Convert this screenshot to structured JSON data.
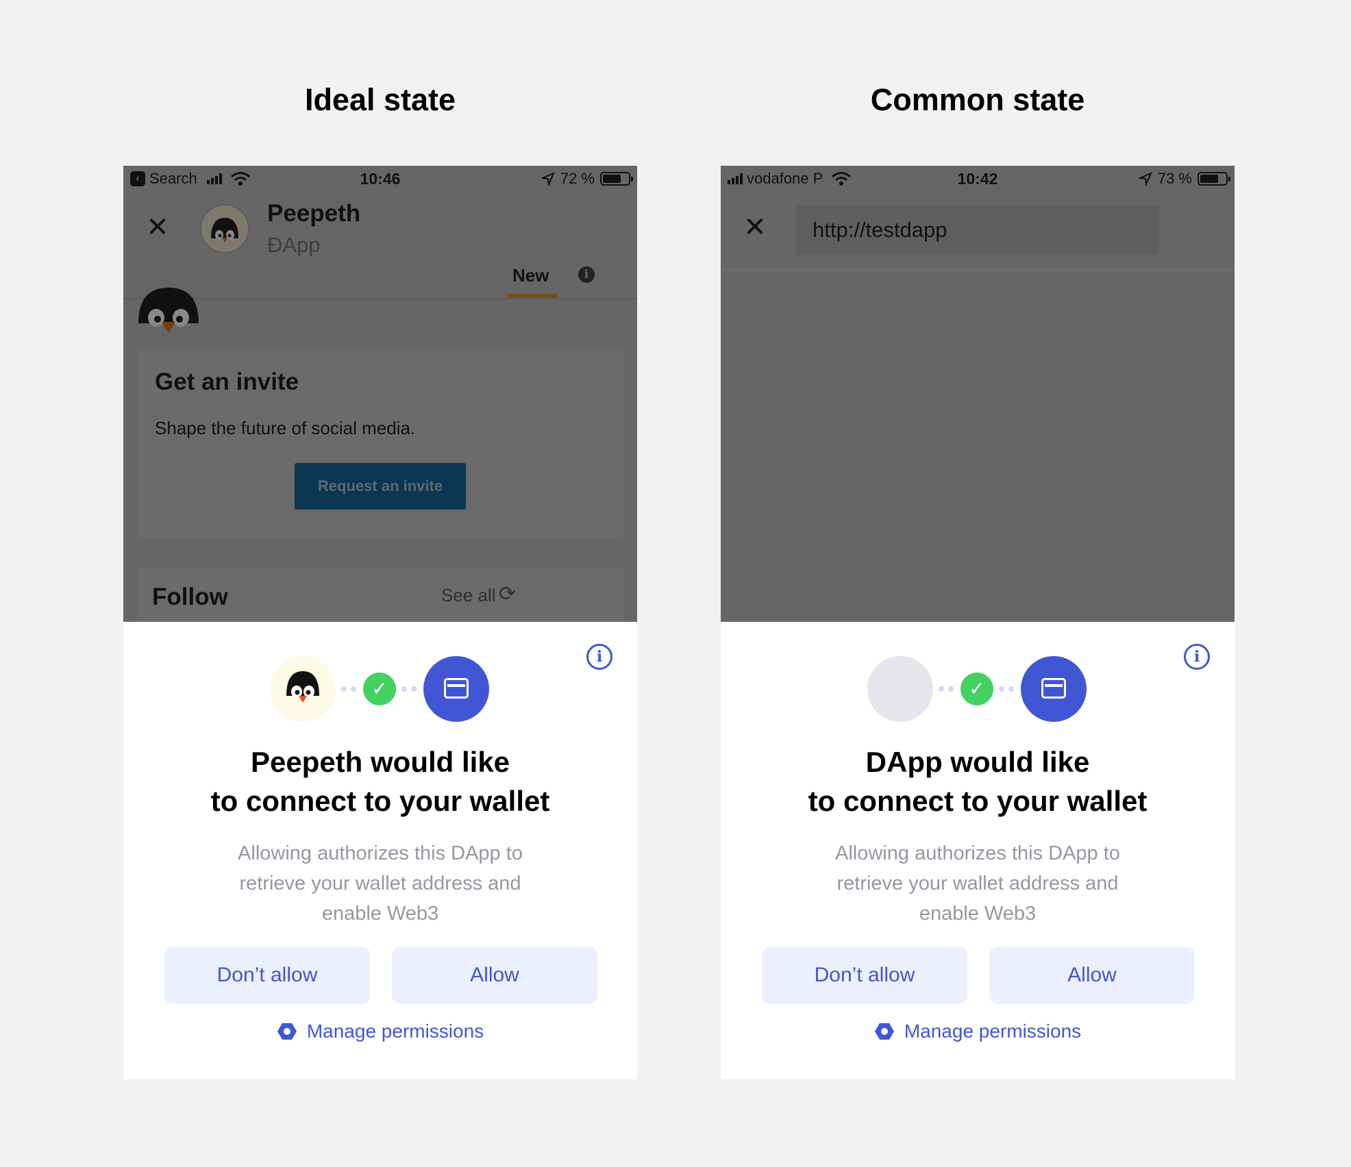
{
  "columns": {
    "left_title": "Ideal state",
    "right_title": "Common state"
  },
  "ideal": {
    "status": {
      "back_label": "Search",
      "time": "10:46",
      "battery": "72 %"
    },
    "dapp_name": "Peepeth",
    "dapp_sub": "ĐApp",
    "tab_new": "New",
    "card": {
      "title": "Get an invite",
      "text": "Shape the future of social media.",
      "button": "Request an invite"
    },
    "follow": {
      "title": "Follow",
      "see_all": "See all"
    },
    "modal": {
      "title_line1": "Peepeth would like",
      "title_line2": "to connect to your wallet",
      "desc_line1": "Allowing authorizes this DApp to",
      "desc_line2": "retrieve your wallet address and",
      "desc_line3": "enable Web3",
      "dont_allow": "Don’t allow",
      "allow": "Allow",
      "manage": "Manage permissions"
    }
  },
  "common": {
    "status": {
      "carrier": "vodafone P",
      "time": "10:42",
      "battery": "73 %"
    },
    "url": "http://testdapp",
    "modal": {
      "title_line1": "DApp would like",
      "title_line2": "to connect to your wallet",
      "desc_line1": "Allowing authorizes this DApp to",
      "desc_line2": "retrieve your wallet address and",
      "desc_line3": "enable Web3",
      "dont_allow": "Don’t allow",
      "allow": "Allow",
      "manage": "Manage permissions"
    }
  },
  "colors": {
    "accent": "#4056d4",
    "button_bg": "#ecf0fc",
    "success": "#43d160",
    "overlay": "#666667"
  },
  "icons": [
    "close-icon",
    "info-icon",
    "check-icon",
    "wallet-icon",
    "manage-permissions-icon",
    "refresh-icon",
    "wifi-icon",
    "location-icon",
    "battery-icon",
    "signal-icon"
  ]
}
